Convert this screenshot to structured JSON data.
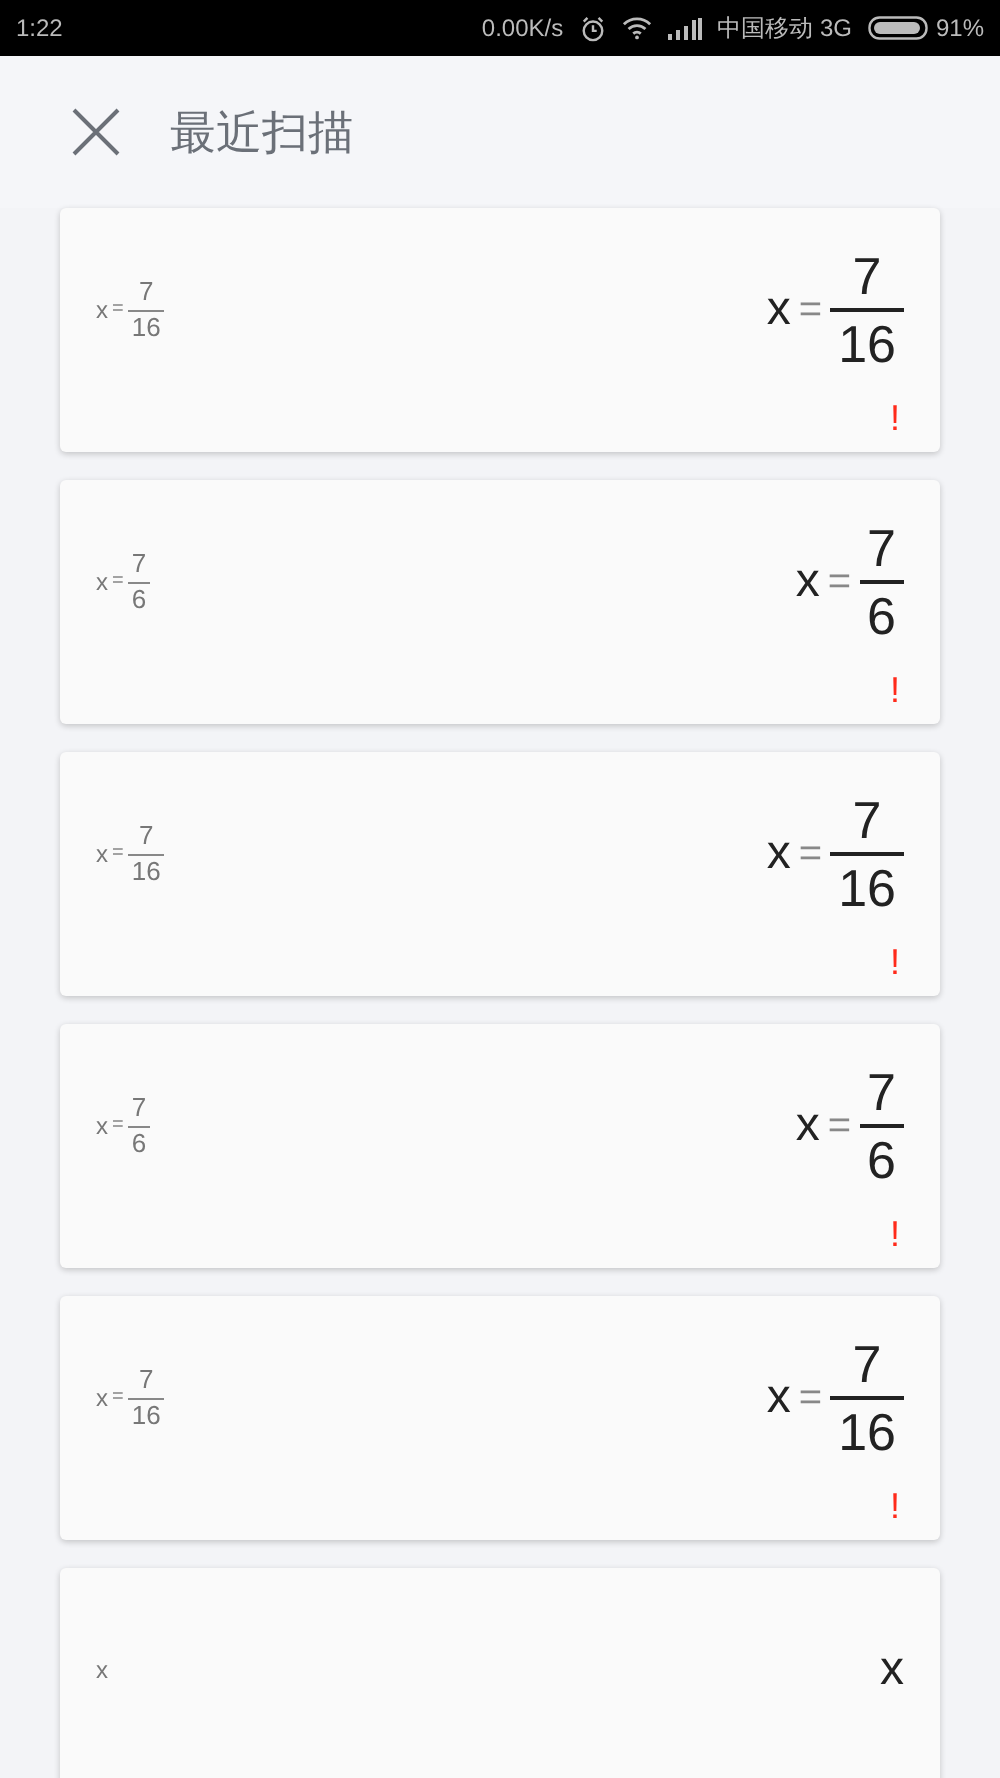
{
  "status_bar": {
    "time": "1:22",
    "speed": "0.00K/s",
    "carrier": "中国移动 3G",
    "battery": "91%"
  },
  "header": {
    "title": "最近扫描"
  },
  "cards": [
    {
      "thumbnail": {
        "kind": "fraction",
        "lhs": "x",
        "op": "=",
        "num": "7",
        "den": "16"
      },
      "result": {
        "kind": "fraction",
        "lhs": "x",
        "op": "=",
        "num": "7",
        "den": "16"
      },
      "warning": "!"
    },
    {
      "thumbnail": {
        "kind": "fraction",
        "lhs": "x",
        "op": "=",
        "num": "7",
        "den": "6"
      },
      "result": {
        "kind": "fraction",
        "lhs": "x",
        "op": "=",
        "num": "7",
        "den": "6"
      },
      "warning": "!"
    },
    {
      "thumbnail": {
        "kind": "fraction",
        "lhs": "x",
        "op": "=",
        "num": "7",
        "den": "16"
      },
      "result": {
        "kind": "fraction",
        "lhs": "x",
        "op": "=",
        "num": "7",
        "den": "16"
      },
      "warning": "!"
    },
    {
      "thumbnail": {
        "kind": "fraction",
        "lhs": "x",
        "op": "=",
        "num": "7",
        "den": "6"
      },
      "result": {
        "kind": "fraction",
        "lhs": "x",
        "op": "=",
        "num": "7",
        "den": "6"
      },
      "warning": "!"
    },
    {
      "thumbnail": {
        "kind": "fraction",
        "lhs": "x",
        "op": "=",
        "num": "7",
        "den": "16"
      },
      "result": {
        "kind": "fraction",
        "lhs": "x",
        "op": "=",
        "num": "7",
        "den": "16"
      },
      "warning": "!"
    },
    {
      "thumbnail": {
        "kind": "plain",
        "text": "x"
      },
      "result": {
        "kind": "plain",
        "text": "x"
      }
    }
  ]
}
